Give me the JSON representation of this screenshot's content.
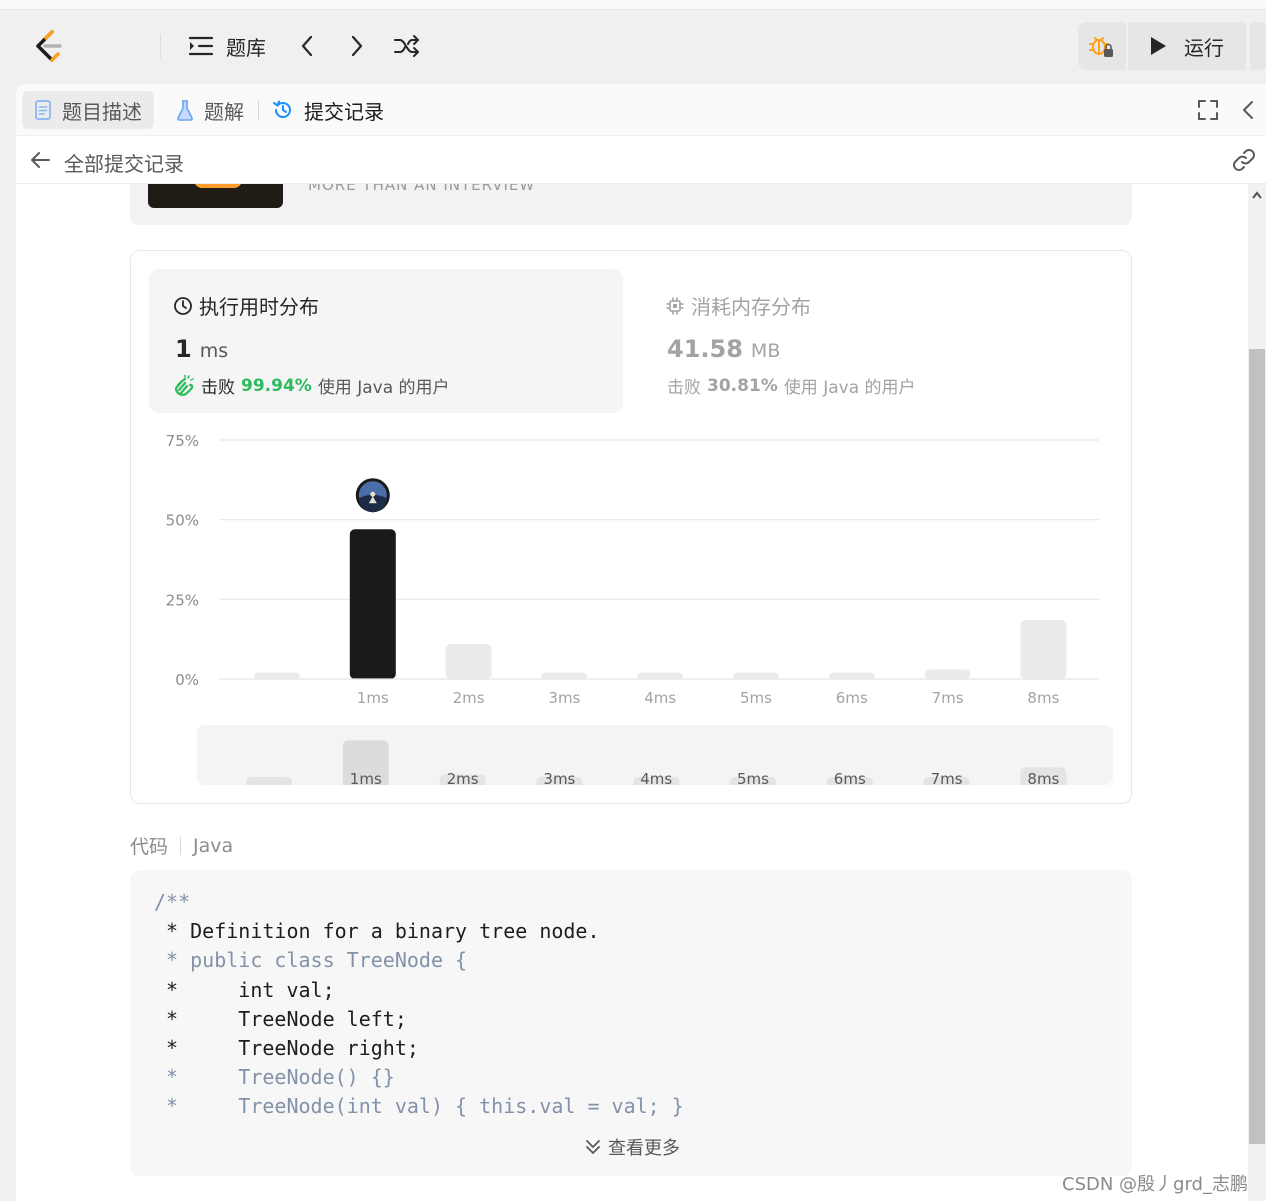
{
  "topnav": {
    "problem_bank_label": "题库",
    "run_label": "运行"
  },
  "tabs": [
    {
      "label": "题目描述",
      "icon": "document-icon"
    },
    {
      "label": "题解",
      "icon": "flask-icon"
    },
    {
      "label": "提交记录",
      "icon": "history-icon"
    }
  ],
  "subheader": {
    "back_label": "全部提交记录"
  },
  "banner": {
    "text": "MORE THAN AN INTERVIEW"
  },
  "runtime": {
    "title": "执行用时分布",
    "value": "1",
    "unit": "ms",
    "beat_prefix": "击败",
    "beat_pct": "99.94%",
    "beat_suffix": "使用 Java 的用户"
  },
  "memory": {
    "title": "消耗内存分布",
    "value": "41.58",
    "unit": "MB",
    "beat_prefix": "击败",
    "beat_pct": "30.81%",
    "beat_suffix": "使用 Java 的用户"
  },
  "chart_data": {
    "type": "bar",
    "categories": [
      "",
      "1ms",
      "2ms",
      "3ms",
      "4ms",
      "5ms",
      "6ms",
      "7ms",
      "8ms"
    ],
    "values": [
      2,
      47,
      11,
      2,
      2,
      2,
      2,
      3,
      18.5
    ],
    "highlight_index": 1,
    "yticks": [
      "75%",
      "50%",
      "25%",
      "0%"
    ],
    "ytick_values": [
      75,
      50,
      25,
      0
    ],
    "ylim": [
      0,
      75
    ],
    "grid": true,
    "colors": {
      "highlight": "#1a1a1a",
      "normal": "#ebebeb"
    }
  },
  "minimap": {
    "labels": [
      "",
      "1ms",
      "2ms",
      "3ms",
      "4ms",
      "5ms",
      "6ms",
      "7ms",
      "8ms"
    ]
  },
  "code": {
    "header_label": "代码",
    "language": "Java",
    "lines": [
      {
        "text": "/**",
        "style": "dim"
      },
      {
        "text": " * Definition for a binary tree node.",
        "style": "dark"
      },
      {
        "text": " * public class TreeNode {",
        "style": "dim"
      },
      {
        "text": " *     int val;",
        "style": "dark"
      },
      {
        "text": " *     TreeNode left;",
        "style": "dark"
      },
      {
        "text": " *     TreeNode right;",
        "style": "dark"
      },
      {
        "text": " *     TreeNode() {}",
        "style": "dim"
      },
      {
        "text": " *     TreeNode(int val) { this.val = val; }",
        "style": "dim"
      }
    ],
    "more_label": "查看更多"
  },
  "watermark": "CSDN @殷丿grd_志鹏"
}
